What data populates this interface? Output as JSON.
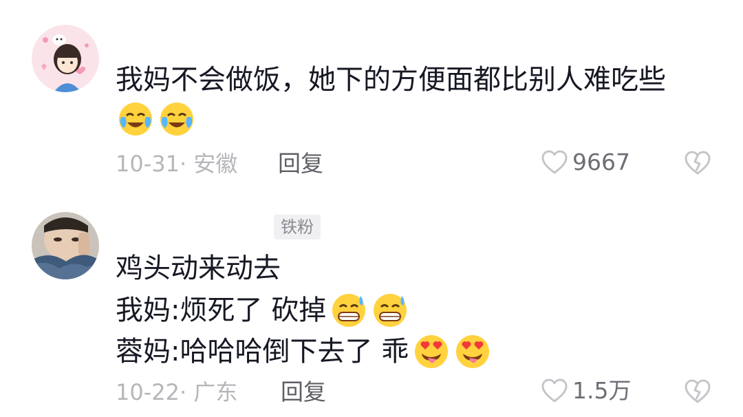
{
  "comments": [
    {
      "text_lines": [
        "我妈不会做饭，她下的方便面都比别人难吃些"
      ],
      "emoji_line": [
        "crying-laughing-emoji",
        "crying-laughing-emoji"
      ],
      "meta": "10-31· 安徽",
      "reply_label": "回复",
      "like_count": "9667"
    },
    {
      "badge": "铁粉",
      "text_lines": [
        "鸡头动来动去",
        "我妈:烦死了 砍掉",
        "蓉妈:哈哈哈倒下去了 乖"
      ],
      "line2_emojis": [
        "grinning-sweat-emoji",
        "grinning-sweat-emoji"
      ],
      "line3_emojis": [
        "heart-eyes-tongue-emoji",
        "heart-eyes-tongue-emoji"
      ],
      "meta": "10-22· 广东",
      "reply_label": "回复",
      "like_count": "1.5万"
    }
  ],
  "colors": {
    "text": "#161823",
    "meta": "#b5b6ba",
    "icon": "#c4c5c9"
  }
}
